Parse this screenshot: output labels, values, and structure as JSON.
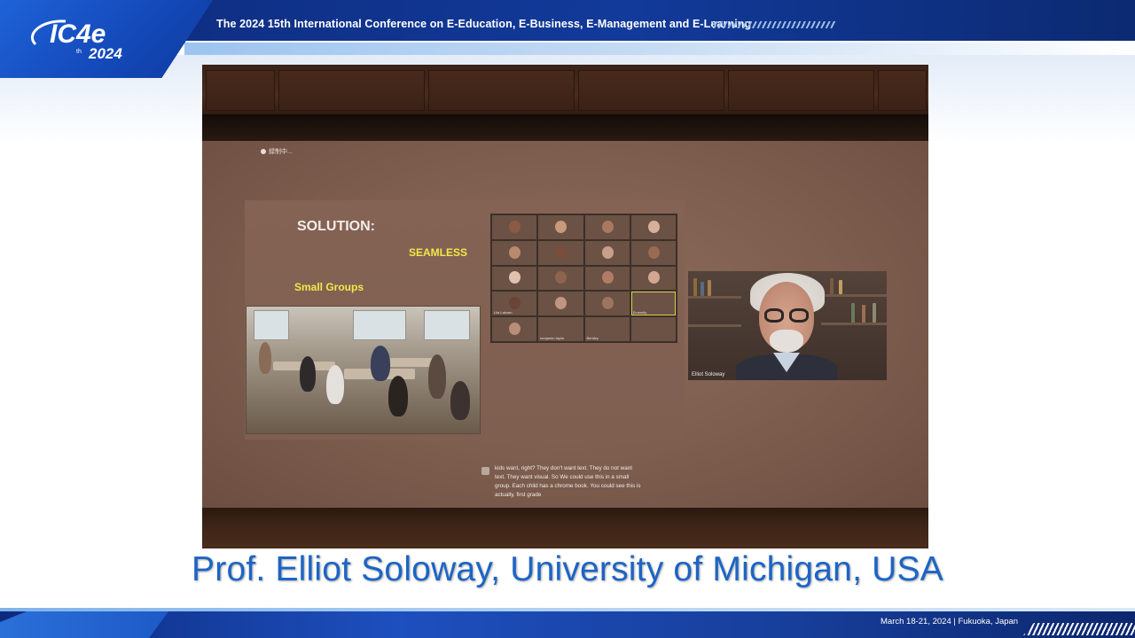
{
  "header": {
    "conference_title": "The 2024 15th International Conference on E-Education, E-Business, E-Management and E-Learning",
    "logo_text": "IC4e",
    "logo_ordinal": "th",
    "logo_year": "2024",
    "accent_color": "#123a9a"
  },
  "photo": {
    "recording_indicator": "録制中...",
    "slide": {
      "title": "SOLUTION:",
      "subtitle": "SEAMLESS",
      "label": "Small Groups"
    },
    "gallery": {
      "participants": [
        "",
        "",
        "",
        "",
        "",
        "",
        "",
        "",
        "",
        "",
        "",
        "",
        "Lila Lakoan",
        "",
        "",
        "Emerelly",
        "",
        "benjamin taylor",
        "Bentley",
        ""
      ]
    },
    "speaker_video": {
      "name": "Elliot Soloway"
    },
    "live_caption": "kids want, right? They don't want text. They do not want text. They want visual. So We could use this in a small group. Each child has a chrome book. You could see this is actually, first grade"
  },
  "caption": {
    "speaker": "Prof. Elliot Soloway, University of Michigan, USA",
    "color": "#1d64c5"
  },
  "footer": {
    "date_location": "March 18-21, 2024  |  Fukuoka, Japan"
  }
}
